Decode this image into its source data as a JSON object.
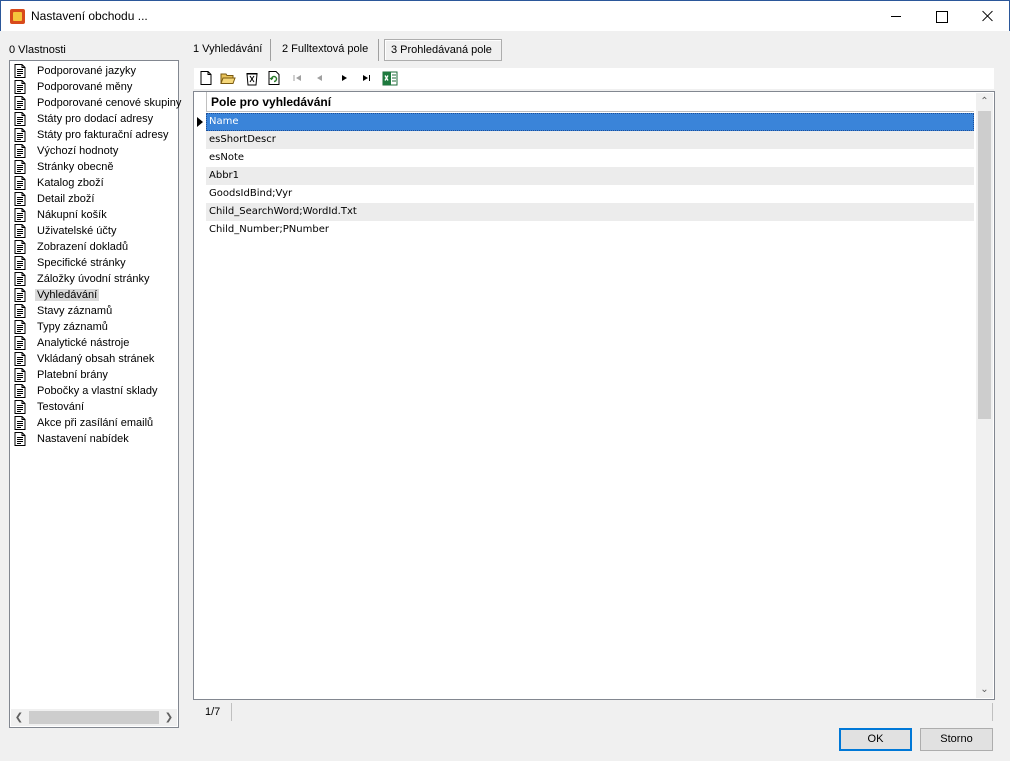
{
  "window": {
    "title": "Nastavení obchodu ..."
  },
  "left": {
    "header": "0 Vlastnosti",
    "items": [
      {
        "label": "Podporované jazyky"
      },
      {
        "label": "Podporované měny"
      },
      {
        "label": "Podporované cenové skupiny"
      },
      {
        "label": "Státy pro dodací adresy"
      },
      {
        "label": "Státy pro fakturační adresy"
      },
      {
        "label": "Výchozí hodnoty"
      },
      {
        "label": "Stránky obecně"
      },
      {
        "label": "Katalog zboží"
      },
      {
        "label": "Detail zboží"
      },
      {
        "label": "Nákupní košík"
      },
      {
        "label": "Uživatelské účty"
      },
      {
        "label": "Zobrazení dokladů"
      },
      {
        "label": "Specifické stránky"
      },
      {
        "label": "Záložky úvodní stránky"
      },
      {
        "label": "Vyhledávání"
      },
      {
        "label": "Stavy záznamů"
      },
      {
        "label": "Typy záznamů"
      },
      {
        "label": "Analytické nástroje"
      },
      {
        "label": "Vkládaný obsah stránek"
      },
      {
        "label": "Platební brány"
      },
      {
        "label": "Pobočky a vlastní sklady"
      },
      {
        "label": "Testování"
      },
      {
        "label": "Akce při zasílání emailů"
      },
      {
        "label": "Nastavení nabídek"
      }
    ],
    "selected_label": "Vyhledávání"
  },
  "tabs": [
    {
      "label": "1 Vyhledávání"
    },
    {
      "label": "2 Fulltextová pole"
    },
    {
      "label": "3 Prohledávaná pole"
    }
  ],
  "active_tab_label": "3 Prohledávaná pole",
  "toolbar": {
    "icons": [
      "new-icon",
      "open-folder-icon",
      "delete-icon",
      "refresh-icon",
      "first-record-icon",
      "previous-record-icon",
      "next-record-icon",
      "last-record-icon",
      "excel-export-icon"
    ]
  },
  "grid": {
    "column_header": "Pole pro vyhledávání",
    "rows": [
      {
        "value": "Name"
      },
      {
        "value": "esShortDescr"
      },
      {
        "value": "esNote"
      },
      {
        "value": "Abbr1"
      },
      {
        "value": "GoodsIdBind;Vyr"
      },
      {
        "value": "Child_SearchWord;WordId.Txt"
      },
      {
        "value": "Child_Number;PNumber"
      }
    ],
    "current_row_value": "Name"
  },
  "status": {
    "position": "1/7"
  },
  "buttons": {
    "ok": "OK",
    "cancel": "Storno"
  },
  "colors": {
    "selection": "#3a84d9",
    "ok_border": "#0078d7"
  }
}
